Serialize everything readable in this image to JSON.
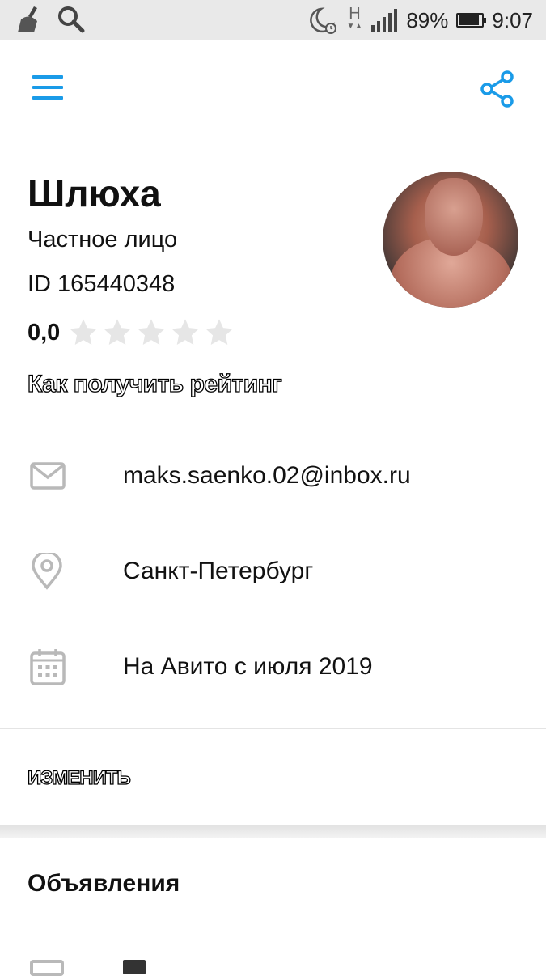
{
  "status_bar": {
    "network": "H",
    "battery_percent": "89%",
    "battery_level": 0.89,
    "time": "9:07",
    "icons": [
      "broom-icon",
      "search-icon",
      "moon-alarm-icon",
      "signal-icon",
      "battery-icon"
    ]
  },
  "toolbar": {
    "menu_icon": "hamburger-menu-icon",
    "share_icon": "share-icon",
    "accent_color": "#1a9be8"
  },
  "profile": {
    "name": "Шлюха",
    "type": "Частное лицо",
    "id": "ID 165440348",
    "rating_value": "0,0",
    "rating_stars": 0,
    "rating_max": 5,
    "rating_link": "Как получить рейтинг"
  },
  "details": {
    "email": "maks.saenko.02@inbox.ru",
    "city": "Санкт-Петербург",
    "since": "На Авито с июля 2019"
  },
  "actions": {
    "edit_label": "ИЗМЕНИТЬ"
  },
  "ads": {
    "title": "Объявления"
  }
}
